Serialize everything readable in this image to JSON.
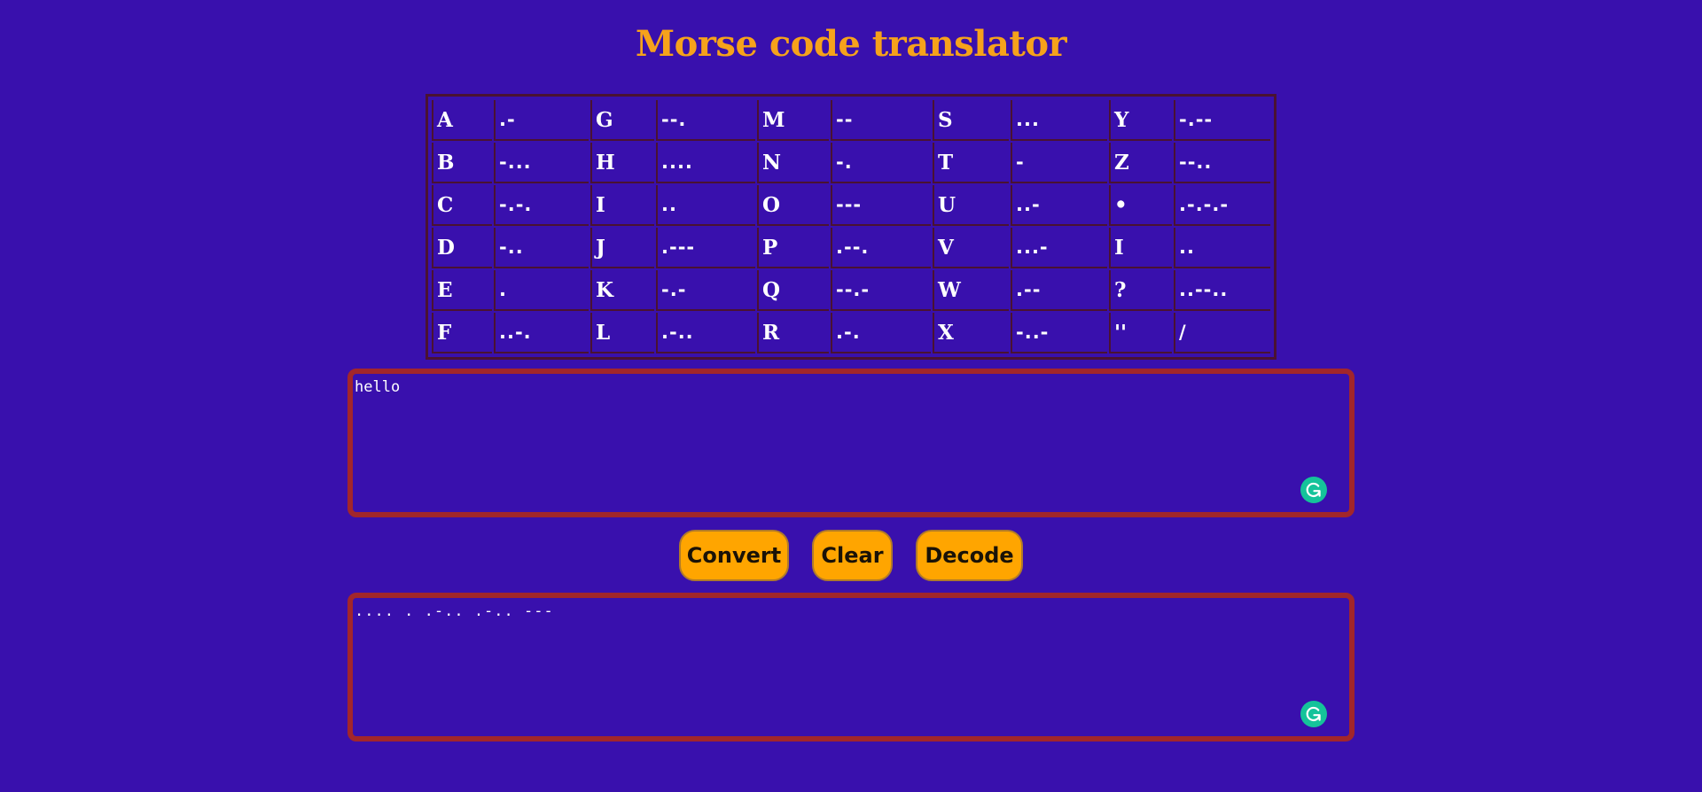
{
  "title": "Morse code translator",
  "morse_table": {
    "rows": [
      [
        [
          "A",
          ".-"
        ],
        [
          "G",
          "--."
        ],
        [
          "M",
          "--"
        ],
        [
          "S",
          "..."
        ],
        [
          "Y",
          "-.--"
        ]
      ],
      [
        [
          "B",
          "-..."
        ],
        [
          "H",
          "...."
        ],
        [
          "N",
          "-."
        ],
        [
          "T",
          "-"
        ],
        [
          "Z",
          "--.."
        ]
      ],
      [
        [
          "C",
          "-.-."
        ],
        [
          "I",
          ".."
        ],
        [
          "O",
          "---"
        ],
        [
          "U",
          "..-"
        ],
        [
          "•",
          ".-.-.-"
        ]
      ],
      [
        [
          "D",
          "-.."
        ],
        [
          "J",
          ".---"
        ],
        [
          "P",
          ".--."
        ],
        [
          "V",
          "...-"
        ],
        [
          "I",
          ".."
        ]
      ],
      [
        [
          "E",
          "."
        ],
        [
          "K",
          "-.-"
        ],
        [
          "Q",
          "--.-"
        ],
        [
          "W",
          ".--"
        ],
        [
          "?",
          "..--.."
        ]
      ],
      [
        [
          "F",
          "..-."
        ],
        [
          "L",
          ".-.."
        ],
        [
          "R",
          ".-."
        ],
        [
          "X",
          "-..-"
        ],
        [
          "''",
          "/"
        ]
      ]
    ]
  },
  "input": {
    "value": "hello"
  },
  "buttons": {
    "convert": "Convert",
    "clear": "Clear",
    "decode": "Decode"
  },
  "output": {
    "value": ".... . .-.. .-.. ---"
  },
  "icons": {
    "grammar_badge": "grammarly-g-icon"
  },
  "colors": {
    "background": "#3910ad",
    "title": "#f6a21b",
    "button": "#ffa500",
    "textbox_border": "#a2262b",
    "table_border": "#4a1232",
    "badge": "#15c39a"
  }
}
